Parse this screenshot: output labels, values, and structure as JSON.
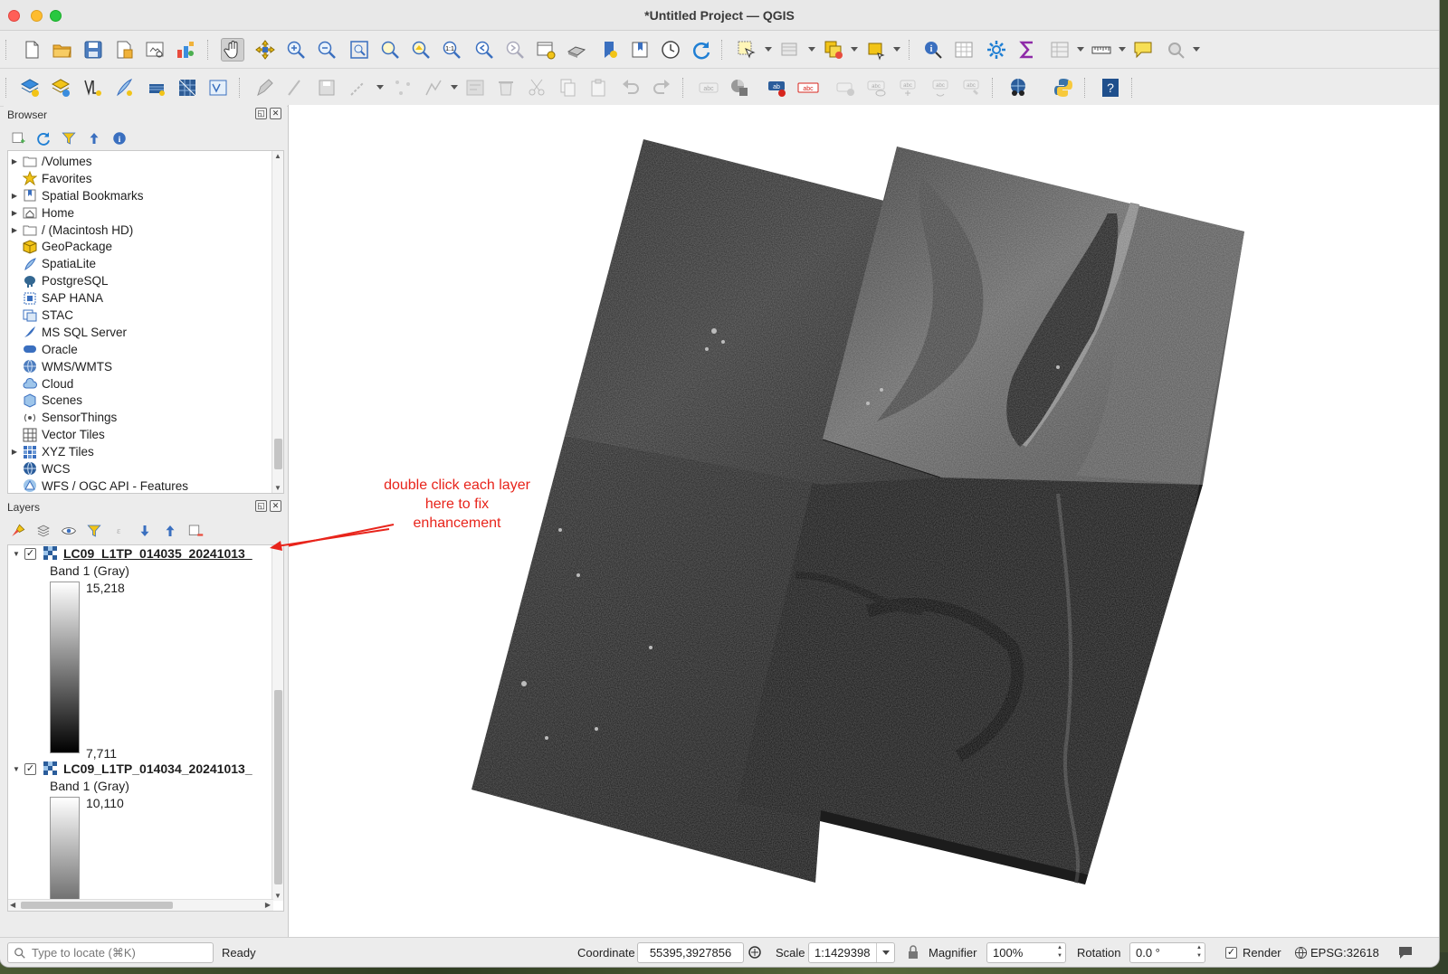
{
  "window": {
    "title": "*Untitled Project — QGIS"
  },
  "toolbar1": {
    "icons": [
      "new-project-icon",
      "open-project-icon",
      "save-project-icon",
      "save-as-icon",
      "print-layout-icon",
      "style-manager-icon",
      "pan-icon",
      "pan-to-selection-icon",
      "zoom-in-icon",
      "zoom-out-icon",
      "zoom-full-icon",
      "zoom-to-selection-icon",
      "zoom-to-layer-icon",
      "zoom-native-icon",
      "zoom-last-icon",
      "zoom-next-icon",
      "new-map-view-icon",
      "new-3d-view-icon",
      "bookmark-new-icon",
      "bookmarks-icon",
      "temporal-controller-icon",
      "refresh-icon",
      "select-features-icon",
      "attribute-table-select-icon",
      "deselect-icon",
      "select-by-location-icon",
      "identify-icon",
      "open-attribute-table-icon",
      "processing-toolbox-icon",
      "statistics-sum-icon",
      "attribute-table-icon",
      "measure-icon",
      "map-tips-icon",
      "locator-options-icon"
    ]
  },
  "toolbar2": {
    "icons": [
      "add-raster-layer-icon",
      "add-vector-layer-icon",
      "add-delimited-text-icon",
      "add-spatialite-icon",
      "add-wms-icon",
      "add-mesh-icon",
      "add-virtual-layer-icon",
      "toggle-editing-icon",
      "digitize-icon",
      "save-edits-icon",
      "add-line-icon",
      "vertex-tool-icon",
      "node-tool-icon",
      "field-calculator-icon",
      "delete-selected-icon",
      "cut-features-icon",
      "copy-features-icon",
      "paste-features-icon",
      "undo-icon",
      "redo-icon",
      "label-tool-icon",
      "diagram-tool-icon",
      "label-toolbar-icon",
      "abc-label-icon",
      "pin-labels-icon",
      "show-hide-labels-icon",
      "move-label-icon",
      "rotate-label-icon",
      "change-label-icon",
      "quickmapservices-icon",
      "python-console-icon",
      "help-icon"
    ]
  },
  "browser": {
    "title": "Browser",
    "items": [
      {
        "label": "/Volumes",
        "icon": "folder-icon",
        "expandable": true
      },
      {
        "label": "Favorites",
        "icon": "star-icon",
        "expandable": false
      },
      {
        "label": "Spatial Bookmarks",
        "icon": "bookmark-icon",
        "expandable": true
      },
      {
        "label": "Home",
        "icon": "home-folder-icon",
        "expandable": true
      },
      {
        "label": "/ (Macintosh HD)",
        "icon": "folder-icon",
        "expandable": true
      },
      {
        "label": "GeoPackage",
        "icon": "geopackage-icon",
        "expandable": false
      },
      {
        "label": "SpatiaLite",
        "icon": "spatialite-icon",
        "expandable": false
      },
      {
        "label": "PostgreSQL",
        "icon": "postgresql-icon",
        "expandable": false
      },
      {
        "label": "SAP HANA",
        "icon": "sap-hana-icon",
        "expandable": false
      },
      {
        "label": "STAC",
        "icon": "stac-icon",
        "expandable": false
      },
      {
        "label": "MS SQL Server",
        "icon": "mssql-icon",
        "expandable": false
      },
      {
        "label": "Oracle",
        "icon": "oracle-icon",
        "expandable": false
      },
      {
        "label": "WMS/WMTS",
        "icon": "wms-icon",
        "expandable": false
      },
      {
        "label": "Cloud",
        "icon": "cloud-icon",
        "expandable": false
      },
      {
        "label": "Scenes",
        "icon": "scenes-icon",
        "expandable": false
      },
      {
        "label": "SensorThings",
        "icon": "sensorthings-icon",
        "expandable": false
      },
      {
        "label": "Vector Tiles",
        "icon": "vector-tiles-icon",
        "expandable": false
      },
      {
        "label": "XYZ Tiles",
        "icon": "xyz-tiles-icon",
        "expandable": true
      },
      {
        "label": "WCS",
        "icon": "wcs-icon",
        "expandable": false
      },
      {
        "label": "WFS / OGC API - Features",
        "icon": "wfs-icon",
        "expandable": false
      }
    ]
  },
  "layers": {
    "title": "Layers",
    "items": [
      {
        "name": "LC09_L1TP_014035_20241013_",
        "band": "Band 1 (Gray)",
        "max": "15,218",
        "min": "7,711",
        "checked": true,
        "selected": true
      },
      {
        "name": "LC09_L1TP_014034_20241013_",
        "band": "Band 1 (Gray)",
        "max": "10,110",
        "checked": true,
        "selected": false
      }
    ]
  },
  "annotation": {
    "text": "double click each layer here to fix enhancement",
    "color": "#e8241b"
  },
  "status": {
    "locator_placeholder": "Type to locate (⌘K)",
    "ready": "Ready",
    "coordinate_label": "Coordinate",
    "coordinate_value": "55395,3927856",
    "scale_label": "Scale",
    "scale_value": "1:1429398",
    "magnifier_label": "Magnifier",
    "magnifier_value": "100%",
    "rotation_label": "Rotation",
    "rotation_value": "0.0 °",
    "render_label": "Render",
    "render_checked": true,
    "crs": "EPSG:32618"
  }
}
